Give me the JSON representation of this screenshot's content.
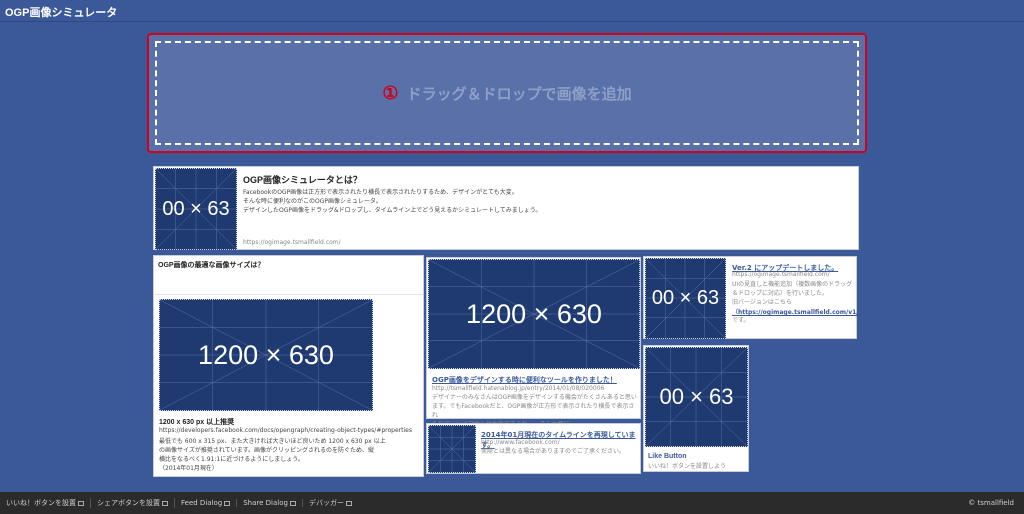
{
  "header": {
    "title": "OGP画像シミュレータ"
  },
  "dropzone": {
    "number": "①",
    "label": "ドラッグ＆ドロップで画像を追加"
  },
  "intro": {
    "thumb_label": "00 × 63",
    "title": "OGP画像シミュレータとは？",
    "desc": [
      "FacebookのOGP画像は正方形で表示されたり横長で表示されたりするため、デザインがとても大変。",
      "そんな時に便利なのがこのOGP画像シミュレータ。",
      "デザインしたOGP画像をドラッグ&ドロップし、タイムライン上でどう見えるかシミュレートしてみましょう。"
    ],
    "url": "https://ogimage.tsmallfield.com/"
  },
  "size_card": {
    "heading": "OGP画像の最適な画像サイズは？",
    "thumb_label": "1200 × 630",
    "title": "1200 x 630 px 以上推奨",
    "url": "https://developers.facebook.com/docs/opengraph/creating-object-types/#properties",
    "desc": [
      "最低でも 600 x 315 px、また大きければ大きいほど良いため 1200 x 630 px 以上",
      "の画像サイズが推奨されています。画像がクリッピングされるのを防ぐため、縦",
      "横比をなるべく1.91:1に近づけるようにしましょう。",
      "（2014年01月現在）"
    ]
  },
  "tool_card": {
    "thumb_label": "1200 × 630",
    "title": "OGP画像をデザインする時に便利なツールを作りました！",
    "url": "http://tsmallfield.hatenablog.jp/entry/2014/01/08/020006",
    "desc": [
      "デザイナーのみなさんはOGP画像をデザインする機会がたくさんあると思い",
      "ます。でもFacebookだと、OGP画像が正方形で表示されたり横長で表示され",
      "たりで、レイアウトが大変ですよね。。。そんな時に……"
    ]
  },
  "timeline_card": {
    "thumb_label": "",
    "title": "2014年01月現在のタイムラインを再現しています。",
    "url": "http://www.facebook.com/",
    "desc": "実際とは異なる場合がありますのでご了承ください。"
  },
  "version_card": {
    "thumb_label": "00 × 63",
    "title": "Ver.2 にアップデートしました。",
    "url": "https://ogimage.tsmallfield.com/",
    "desc": [
      "UIの見直しと機能追加（複数画像のドラッグ",
      "＆ドロップに対応）を行いました。",
      "旧バージョンはこちら"
    ],
    "link": "（https://ogimage.tsmallfield.com/v1/）",
    "tail": "です。"
  },
  "like_card": {
    "thumb_label": "00 × 63",
    "title": "Like Button",
    "desc": "いいね！ボタンを設置しよう"
  },
  "footer": {
    "items": [
      "いいね！ボタンを設置",
      "シェアボタンを設置",
      "Feed Dialog",
      "Share Dialog",
      "デバッガー"
    ],
    "copyright": "© tsmallfield"
  },
  "colors": {
    "brand": "#3b5998",
    "accent": "#d0021b",
    "thumb": "#1f3a70"
  }
}
